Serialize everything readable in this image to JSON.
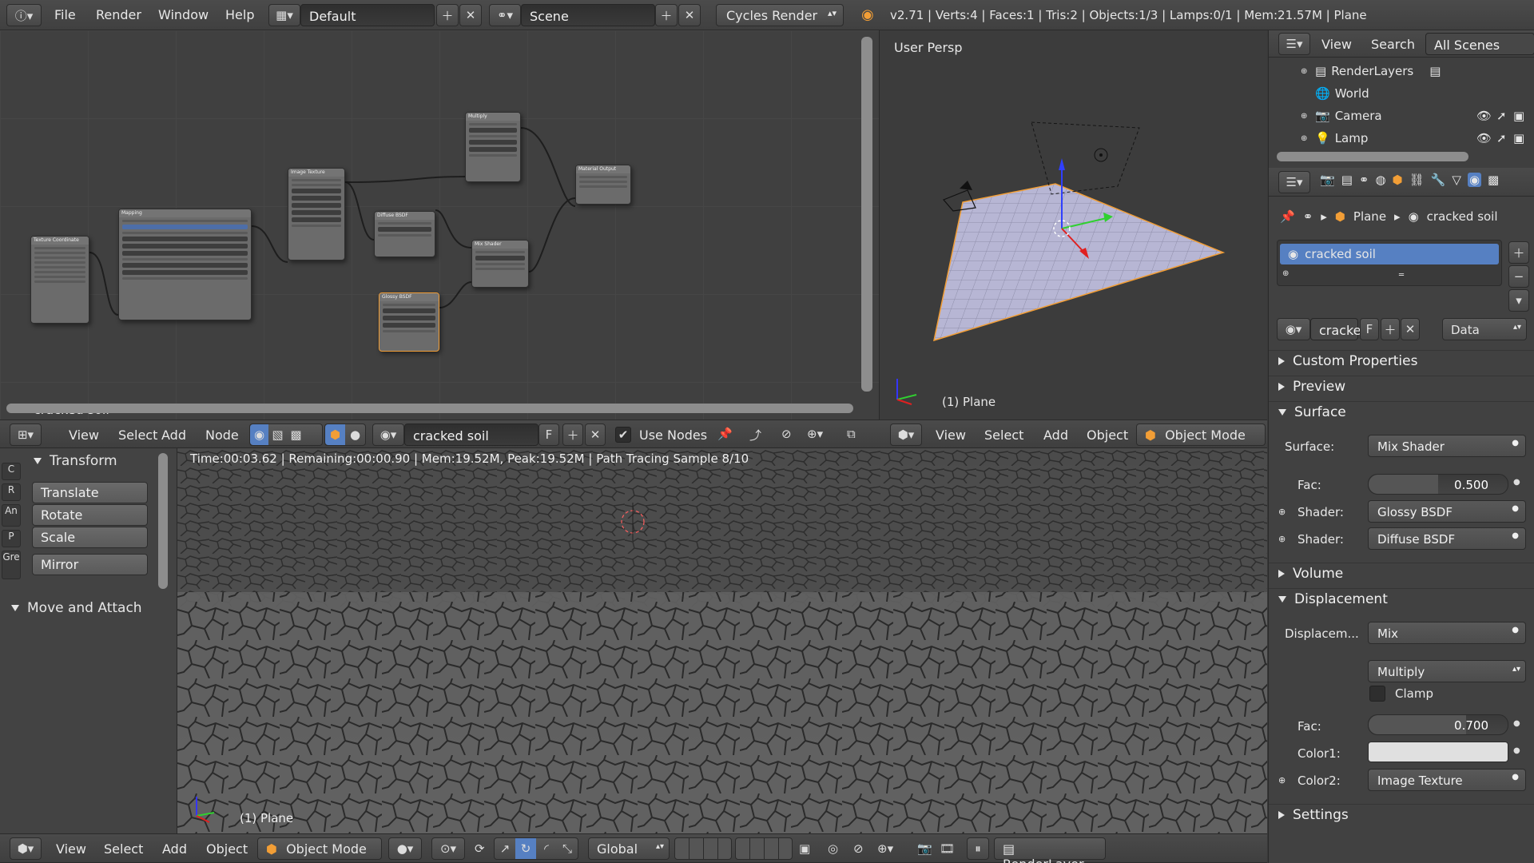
{
  "topbar": {
    "menus": [
      "File",
      "Render",
      "Window",
      "Help"
    ],
    "layout": "Default",
    "scene": "Scene",
    "engine": "Cycles Render",
    "stats": "v2.71 | Verts:4 | Faces:1 | Tris:2 | Objects:1/3 | Lamps:0/1 | Mem:21.57M | Plane"
  },
  "node_editor": {
    "material_label": "cracked soil",
    "header": {
      "menus": [
        "View",
        "Select",
        "Add",
        "Node"
      ],
      "material": "cracked soil",
      "fake_user": "F",
      "use_nodes": "Use Nodes"
    }
  },
  "viewport": {
    "title": "User Persp",
    "object_label": "(1) Plane",
    "header": {
      "menus": [
        "View",
        "Select",
        "Add",
        "Object"
      ],
      "mode": "Object Mode"
    }
  },
  "outliner": {
    "header": {
      "view": "View",
      "search": "Search",
      "filter": "All Scenes"
    },
    "items": [
      "RenderLayers",
      "World",
      "Camera",
      "Lamp"
    ]
  },
  "properties": {
    "breadcrumb": {
      "object": "Plane",
      "material": "cracked soil"
    },
    "slot_name": "cracked soil",
    "datablock": "cracke",
    "fake_user": "F",
    "link": "Data",
    "panels": {
      "custom_properties": "Custom Properties",
      "preview": "Preview",
      "surface": "Surface",
      "volume": "Volume",
      "displacement": "Displacement",
      "settings": "Settings"
    },
    "surface": {
      "surface_label": "Surface:",
      "surface_value": "Mix Shader",
      "fac_label": "Fac:",
      "fac_value": "0.500",
      "shader1_label": "Shader:",
      "shader1_value": "Glossy BSDF",
      "shader2_label": "Shader:",
      "shader2_value": "Diffuse BSDF"
    },
    "displacement": {
      "disp_label": "Displacem...",
      "disp_value": "Mix",
      "blend": "Multiply",
      "clamp": "Clamp",
      "fac_label": "Fac:",
      "fac_value": "0.700",
      "color1_label": "Color1:",
      "color2_label": "Color2:",
      "color2_value": "Image Texture"
    }
  },
  "render_view": {
    "status": "Time:00:03.62 | Remaining:00:00.90 | Mem:19.52M, Peak:19.52M | Path Tracing Sample 8/10",
    "object_label": "(1) Plane"
  },
  "toolshelf": {
    "transform_title": "Transform",
    "buttons": [
      "Translate",
      "Rotate",
      "Scale",
      "Mirror"
    ],
    "move_attach": "Move and Attach",
    "tabs": [
      "C",
      "R",
      "An",
      "P",
      "Gre"
    ]
  },
  "bottom_header": {
    "menus": [
      "View",
      "Select",
      "Add",
      "Object"
    ],
    "mode": "Object Mode",
    "orientation": "Global",
    "render_layer": "RenderLayer"
  },
  "colors": {
    "accent_blue": "#5680c2",
    "selected_orange": "#f29e36",
    "socket_yellow": "#c7c729"
  }
}
